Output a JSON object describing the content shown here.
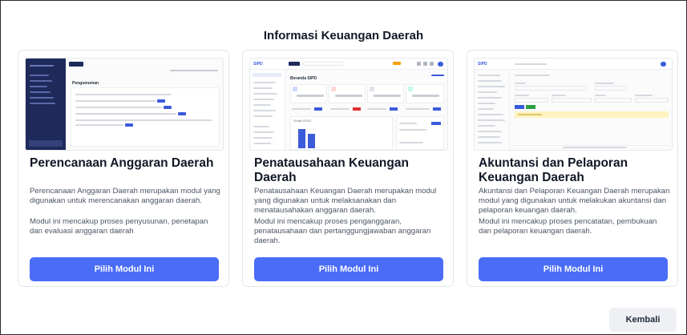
{
  "page": {
    "title": "Informasi Keuangan Daerah",
    "back_label": "Kembali"
  },
  "modules": [
    {
      "title": "Perencanaan Anggaran Daerah",
      "desc1": "Perencanaan Anggaran Daerah merupakan modul yang digunakan untuk merencanakan anggaran daerah.",
      "desc2": "Modul ini mencakup proses penyusunan, penetapan dan evaluasi anggaran daerah",
      "button": "Pilih Modul Ini"
    },
    {
      "title": "Penatausahaan Keuangan Daerah",
      "desc1": "Penatausahaan Keuangan Daerah merupakan modul yang digunakan untuk melaksanakan dan menatausahakan anggaran daerah.",
      "desc2": "Modul ini mencakup proses penganggaran, penatausahaan dan pertanggungjawaban anggaran daerah.",
      "button": "Pilih Modul Ini"
    },
    {
      "title": "Akuntansi dan Pelaporan Keuangan Daerah",
      "desc1": "Akuntansi dan Pelaporan Keuangan Daerah merupakan modul yang digunakan untuk melakukan akuntansi dan pelaporan keuangan daerah.",
      "desc2": "Modul ini mencakup proses pencatatan, pembukuan dan pelaporan keuangan daerah.",
      "button": "Pilih Modul Ini"
    }
  ],
  "thumbs": {
    "t1_heading": "Pengumuman",
    "t1_sidebar_button": "Keluar Akun",
    "t2_heading": "Beranda SIPD",
    "t2_chart_label": "Grafik SP2D",
    "t3_logo": "SIPD",
    "t2_logo": "SIPD"
  },
  "colors": {
    "primary": "#4a6cf7",
    "sidebar_dark": "#1e2a5a"
  }
}
